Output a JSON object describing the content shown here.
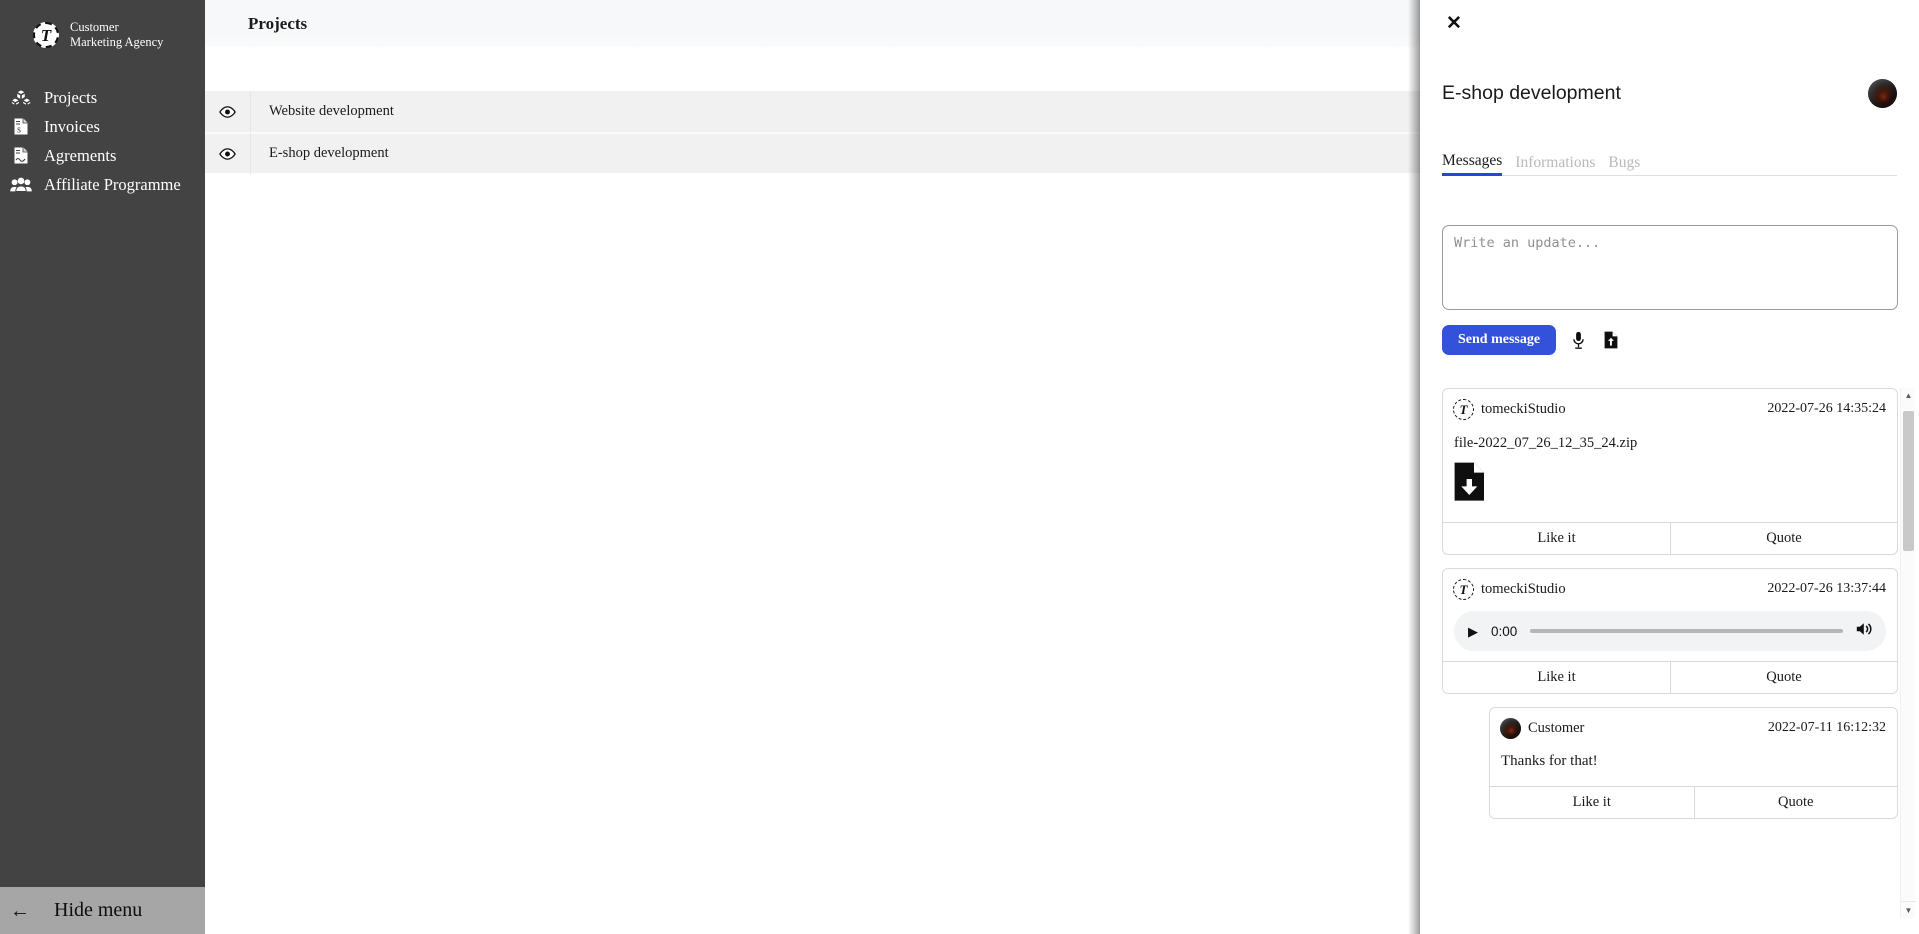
{
  "sidebar": {
    "brand": {
      "logo_letter": "T",
      "line1": "Customer",
      "line2": "Marketing Agency"
    },
    "items": [
      {
        "label": "Projects",
        "icon": "boxes-icon"
      },
      {
        "label": "Invoices",
        "icon": "invoice-document-icon"
      },
      {
        "label": "Agrements",
        "icon": "agreement-document-icon"
      },
      {
        "label": "Affiliate Programme",
        "icon": "users-group-icon"
      }
    ],
    "hide_menu": {
      "label": "Hide menu",
      "icon": "arrow-left-icon"
    }
  },
  "main": {
    "header": {
      "title": "Projects"
    },
    "projects": [
      {
        "name": "Website development",
        "icon": "eye-icon"
      },
      {
        "name": "E-shop development",
        "icon": "eye-icon"
      }
    ]
  },
  "panel": {
    "close_icon": "✕",
    "title": "E-shop development",
    "avatar": "user-avatar",
    "tabs": [
      {
        "label": "Messages",
        "active": true
      },
      {
        "label": "Informations",
        "active": false
      },
      {
        "label": "Bugs",
        "active": false
      }
    ],
    "composer": {
      "placeholder": "Write an update...",
      "value": "",
      "send_label": "Send message",
      "mic_icon": "microphone-icon",
      "attach_icon": "file-upload-icon"
    },
    "actions": {
      "like_label": "Like it",
      "quote_label": "Quote"
    },
    "messages": [
      {
        "author": "tomeckiStudio",
        "avatar_type": "logo",
        "timestamp": "2022-07-26 14:35:24",
        "type": "file",
        "filename": "file-2022_07_26_12_35_24.zip",
        "download_icon": "file-download-icon",
        "indent": false
      },
      {
        "author": "tomeckiStudio",
        "avatar_type": "logo",
        "timestamp": "2022-07-26 13:37:44",
        "type": "audio",
        "audio": {
          "time": "0:00",
          "play_icon": "play-icon",
          "volume_icon": "volume-icon"
        },
        "indent": false
      },
      {
        "author": "Customer",
        "avatar_type": "photo",
        "timestamp": "2022-07-11 16:12:32",
        "type": "text",
        "text": "Thanks for that!",
        "indent": true
      }
    ],
    "scrollbar": {
      "up": "▲",
      "down": "▼"
    }
  },
  "colors": {
    "sidebar_bg": "#434343",
    "accent": "#3451dc",
    "tab_underline": "#2747d8",
    "row_bg": "#f1f1f1",
    "hide_menu_bg": "#a6a6a6"
  }
}
